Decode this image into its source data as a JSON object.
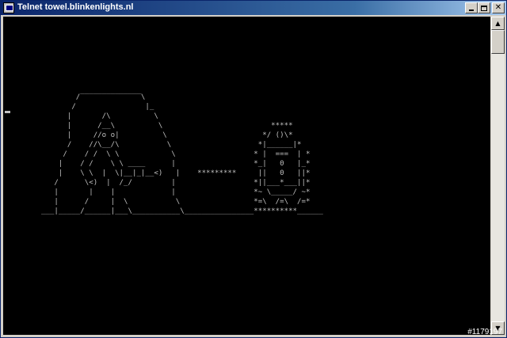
{
  "window": {
    "title": "Telnet towel.blinkenlights.nl",
    "controls": {
      "minimize_icon": "minimize-icon",
      "maximize_icon": "maximize-icon",
      "close_icon": "close-icon"
    },
    "colors": {
      "titlebar_start": "#0a246a",
      "titlebar_end": "#a6caf0",
      "console_bg": "#000000",
      "console_fg": "#c0c0c0"
    }
  },
  "console": {
    "ascii_art": "        /‾‾‾‾‾‾‾‾‾‾‾‾‾‾\\\n       /                |_\n      |       /\\          \\\n      |      /__\\          \\                         *****\n      |     //o o|          \\                      */ ()\\*\n      /    //\\__/\\           \\                    *|______|*\n     /    / /  \\ \\            \\                  * |  ===  | *\n    |    / /    \\ \\ ____      |                  *_|   0   |_*\n    |    \\ \\  |  \\|__|_|__<)   |    *********     ||   0   ||*\n   /      \\<)  |  /_/         |                  *||___*___||*\n   |       |    |             |                  *~ \\_____/ ~*\n   |      /     |  \\           \\                 *=\\  /=\\  /=*\n___|_____/______|___\\___________\\________________**********______"
  },
  "watermark": "#1179197"
}
